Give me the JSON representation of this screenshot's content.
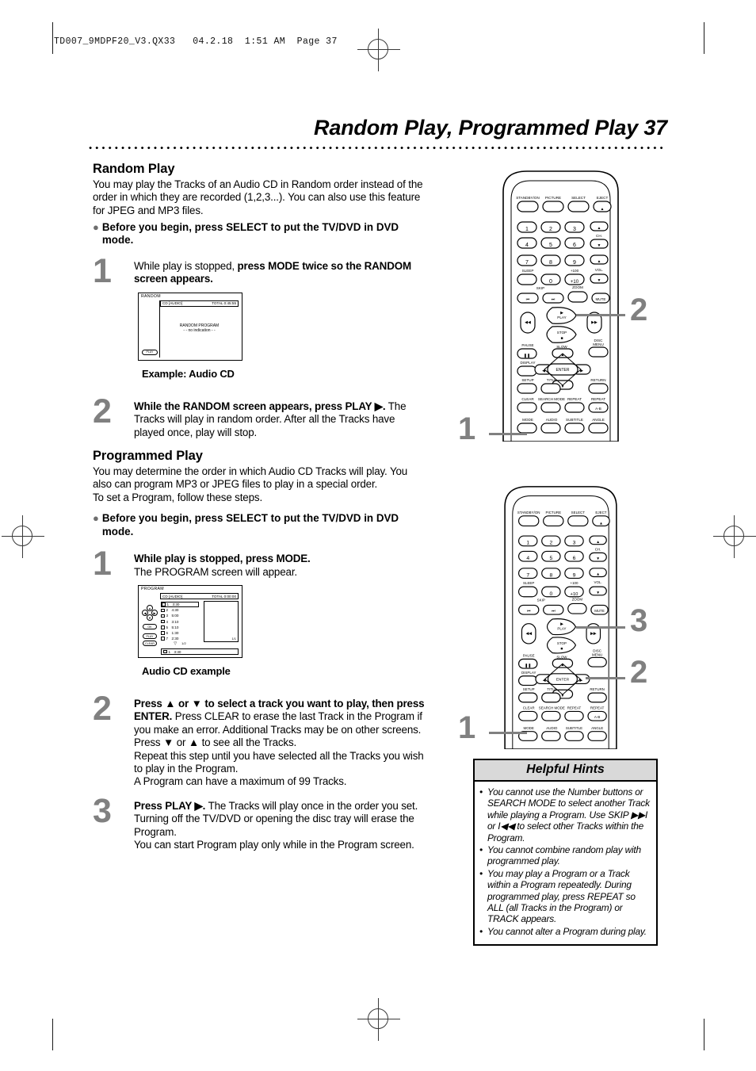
{
  "file_header": "TD007_9MDPF20_V3.QX33   04.2.18  1:51 AM  Page 37",
  "page_title": "Random Play, Programmed Play  37",
  "sections": {
    "random": {
      "heading": "Random Play",
      "intro": "You may play the Tracks of an Audio CD in Random order instead of the order in which they are recorded (1,2,3...). You can also use this feature for JPEG and MP3 files.",
      "bullet": "Before you begin, press SELECT to put the TV/DVD in DVD mode.",
      "step1_num": "1",
      "step1_bold": "While play is stopped, press MODE twice so the RANDOM screen appears.",
      "step1_lead": "While play is stopped, ",
      "caption": "Example: Audio CD",
      "step2_num": "2",
      "step2_bold": "While the RANDOM screen appears, press PLAY ▶.",
      "step2_rest": "The Tracks will play in random order. After all the Tracks have played once, play will stop."
    },
    "programmed": {
      "heading": "Programmed Play",
      "intro": "You may determine the order in which Audio CD Tracks will play. You also can program MP3 or JPEG files to play in a special order.",
      "intro2": "To set a Program, follow these steps.",
      "bullet": "Before you begin, press SELECT to put the TV/DVD in DVD mode.",
      "step1_num": "1",
      "step1_bold": "While play is stopped, press MODE.",
      "step1_rest": "The PROGRAM screen will appear.",
      "caption": "Audio CD example",
      "step2_num": "2",
      "step2_bold": "Press ▲ or ▼ to select a track you want to play, then press ENTER.",
      "step2_rest": "Press CLEAR to erase the last Track in the Program if you make an error. Additional Tracks may be on other screens.  Press ▼ or ▲ to see all the Tracks.",
      "step2_rest2": "Repeat this step until you have selected all the Tracks you wish to play in the Program.",
      "step2_rest3": "A Program can have a maximum of 99 Tracks.",
      "step3_num": "3",
      "step3_bold": "Press PLAY ▶.",
      "step3_rest": "The Tracks will play once in the order you set. Turning off the TV/DVD or opening the disc tray will erase the Program.",
      "step3_rest2": "You can start Program play only while in the Program screen."
    }
  },
  "osd_random": {
    "mode_label": "RANDOM",
    "disc_type": "CD [AUDIO]",
    "total_label": "TOTAL  0:45:55",
    "center_line1": "RANDOM PROGRAM",
    "center_line2": "- -  no indication  - -",
    "corner_button": "PLAY"
  },
  "osd_program": {
    "mode_label": "PROGRAM",
    "disc_type": "CD [AUDIO]",
    "total_label": "TOTAL  0:00:00",
    "tracks": [
      {
        "no": "1",
        "time": "3:30"
      },
      {
        "no": "2",
        "time": "4:30"
      },
      {
        "no": "3",
        "time": "5:00"
      },
      {
        "no": "4",
        "time": "3:10"
      },
      {
        "no": "5",
        "time": "5:10"
      },
      {
        "no": "6",
        "time": "1:30"
      },
      {
        "no": "7",
        "time": "2:30"
      }
    ],
    "selected_index": 0,
    "page_left": "1/2",
    "page_right": "1/1",
    "bottom_no": "1",
    "bottom_time": "3:30",
    "ok_button": "OK",
    "play_button": "PLAY",
    "clear_button": "CLEAR"
  },
  "remote": {
    "row_top": [
      "STANDBY/ON",
      "PICTURE",
      "SELECT",
      "EJECT"
    ],
    "numbers": [
      "1",
      "2",
      "3",
      "4",
      "5",
      "6",
      "7",
      "8",
      "9",
      "0"
    ],
    "plus100": "+100",
    "plus10": "+10",
    "sleep": "SLEEP",
    "ch": "CH.",
    "vol": "VOL.",
    "skip": "SKIP",
    "zoom": "ZOOM",
    "mute": "MUTE",
    "play": "PLAY",
    "stop": "STOP",
    "pause": "PAUSE",
    "slow": "SLOW",
    "disc_menu_l1": "DISC",
    "disc_menu_l2": "MENU",
    "display": "DISPLAY",
    "enter": "ENTER",
    "setup": "SETUP",
    "title": "TITLE",
    "return": "RETURN",
    "clear": "CLEAR",
    "search_mode": "SEARCH MODE",
    "repeat": "REPEAT",
    "repeat_ab_label": "REPEAT",
    "repeat_ab": "A-B",
    "mode": "MODE",
    "audio": "AUDIO",
    "subtitle": "SUBTITLE",
    "angle": "ANGLE"
  },
  "callouts": {
    "remote1_a": "2",
    "remote1_b": "1",
    "remote2_a": "3",
    "remote2_b": "2",
    "remote2_c": "1"
  },
  "hints": {
    "title": "Helpful Hints",
    "items": [
      "You cannot use the Number buttons or SEARCH MODE to select another Track while playing a Program.  Use SKIP ▶▶I or I◀◀ to select other Tracks within the Program.",
      "You cannot combine random play with programmed play.",
      "You may play a Program or a Track within a Program repeatedly. During programmed play, press REPEAT so ALL (all Tracks in the Program) or TRACK appears.",
      "You cannot alter a Program during play."
    ]
  }
}
